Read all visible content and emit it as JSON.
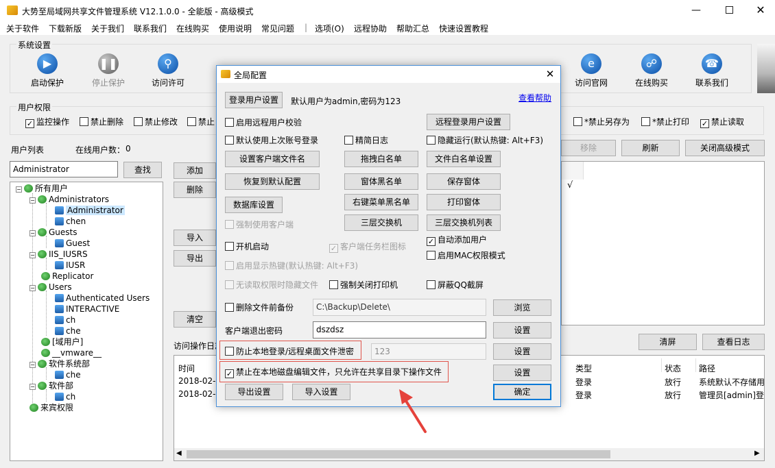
{
  "window": {
    "title": "大势至局域网共享文件管理系统 V12.1.0.0 - 全能版 - 高级模式"
  },
  "menu": [
    "关于软件",
    "下载新版",
    "关于我们",
    "联系我们",
    "在线购买",
    "使用说明",
    "常见问题",
    "|",
    "选项(O)",
    "远程协助",
    "帮助汇总",
    "快速设置教程"
  ],
  "system_settings": {
    "title": "系统设置",
    "tools": [
      {
        "label": "启动保护",
        "icon": "play-icon"
      },
      {
        "label": "停止保护",
        "icon": "pause-icon"
      },
      {
        "label": "访问许可",
        "icon": "key-icon"
      },
      {
        "label": "访问官网",
        "icon": "ie-icon"
      },
      {
        "label": "在线购买",
        "icon": "cart-icon"
      },
      {
        "label": "联系我们",
        "icon": "phone-icon"
      }
    ]
  },
  "user_permissions": {
    "title": "用户权限",
    "items": [
      {
        "label": "监控操作",
        "checked": true
      },
      {
        "label": "禁止删除",
        "checked": false
      },
      {
        "label": "禁止修改",
        "checked": false
      },
      {
        "label": "禁止",
        "checked": false
      },
      {
        "label": "*禁止另存为",
        "checked": false
      },
      {
        "label": "*禁止打印",
        "checked": false
      },
      {
        "label": "禁止读取",
        "checked": true
      }
    ]
  },
  "user_list": {
    "title": "用户列表",
    "online_label": "在线用户数：",
    "online_count": "0",
    "search_value": "Administrator",
    "search_button": "查找",
    "tree": [
      {
        "label": "所有用户",
        "level": 0
      },
      {
        "label": "Administrators",
        "level": 1
      },
      {
        "label": "Administrator",
        "level": 2,
        "selected": true
      },
      {
        "label": "chen",
        "level": 2
      },
      {
        "label": "Guests",
        "level": 1
      },
      {
        "label": "Guest",
        "level": 2
      },
      {
        "label": "IIS_IUSRS",
        "level": 1
      },
      {
        "label": "IUSR",
        "level": 2
      },
      {
        "label": "Replicator",
        "level": 1
      },
      {
        "label": "Users",
        "level": 1
      },
      {
        "label": "Authenticated Users",
        "level": 2
      },
      {
        "label": "INTERACTIVE",
        "level": 2
      },
      {
        "label": "ch",
        "level": 2
      },
      {
        "label": "che",
        "level": 2
      },
      {
        "label": "[域用户]",
        "level": 1
      },
      {
        "label": "__vmware__",
        "level": 1
      },
      {
        "label": "软件系统部",
        "level": 1
      },
      {
        "label": "che",
        "level": 2
      },
      {
        "label": "软件部",
        "level": 1
      },
      {
        "label": "ch",
        "level": 2
      },
      {
        "label": "来宾权限",
        "level": 0
      }
    ]
  },
  "side_buttons": {
    "add": "添加",
    "delete": "删除",
    "import": "导入",
    "export": "导出",
    "clear": "清空"
  },
  "right_buttons": {
    "remove": "移除",
    "refresh": "刷新",
    "close_advanced": "关闭高级模式"
  },
  "log": {
    "title": "访问操作日志",
    "clear_screen": "清屏",
    "view_log": "查看日志",
    "columns": [
      "时间",
      "类型",
      "状态",
      "路径"
    ],
    "rows": [
      {
        "time": "2018-02-0",
        "type": "登录",
        "status": "放行",
        "path": "系统默认不存储用"
      },
      {
        "time": "2018-02-0",
        "type": "登录",
        "status": "放行",
        "path": "管理员[admin]登"
      }
    ]
  },
  "dialog": {
    "title": "全局配置",
    "login_settings_button": "登录用户设置",
    "default_user_text": "默认用户为admin,密码为123",
    "help_link": "查看帮助",
    "remote_login_button": "远程登录用户设置",
    "checks": {
      "remote_verify": "启用远程用户校验",
      "use_last_account": "默认使用上次账号登录",
      "simple_log": "精简日志",
      "hidden_run": "隐藏运行(默认热键: Alt+F3)",
      "force_client": "强制使用客户端",
      "auto_start": "开机启动",
      "tray_icon": "客户端任务栏图标",
      "auto_add_user": "自动添加用户",
      "enable_hotkey": "启用显示热键(默认热键: Alt+F3)",
      "mac_mode": "启用MAC权限模式",
      "hide_no_permission": "无读取权限时隐藏文件",
      "force_close_printer": "强制关闭打印机",
      "block_qq_screenshot": "屏蔽QQ截屏",
      "backup_before_delete": "删除文件前备份",
      "prevent_local_login": "防止本地登录/远程桌面文件泄密",
      "forbid_local_edit": "禁止在本地磁盘编辑文件，只允许在共享目录下操作文件"
    },
    "buttons": {
      "set_client_filename": "设置客户端文件名",
      "drag_whitelist": "拖拽白名单",
      "file_whitelist": "文件白名单设置",
      "restore_default": "恢复到默认配置",
      "window_blacklist": "窗体黑名单",
      "save_window": "保存窗体",
      "database_settings": "数据库设置",
      "context_menu_blacklist": "右键菜单黑名单",
      "print_window": "打印窗体",
      "layer3_switch": "三层交换机",
      "layer3_switch_list": "三层交换机列表",
      "browse": "浏览",
      "set1": "设置",
      "set2": "设置",
      "set3": "设置",
      "export_settings": "导出设置",
      "import_settings": "导入设置",
      "ok": "确定"
    },
    "backup_path": "C:\\Backup\\Delete\\",
    "exit_password_label": "客户端退出密码",
    "exit_password": "dszdsz",
    "prevent_password": "123"
  }
}
